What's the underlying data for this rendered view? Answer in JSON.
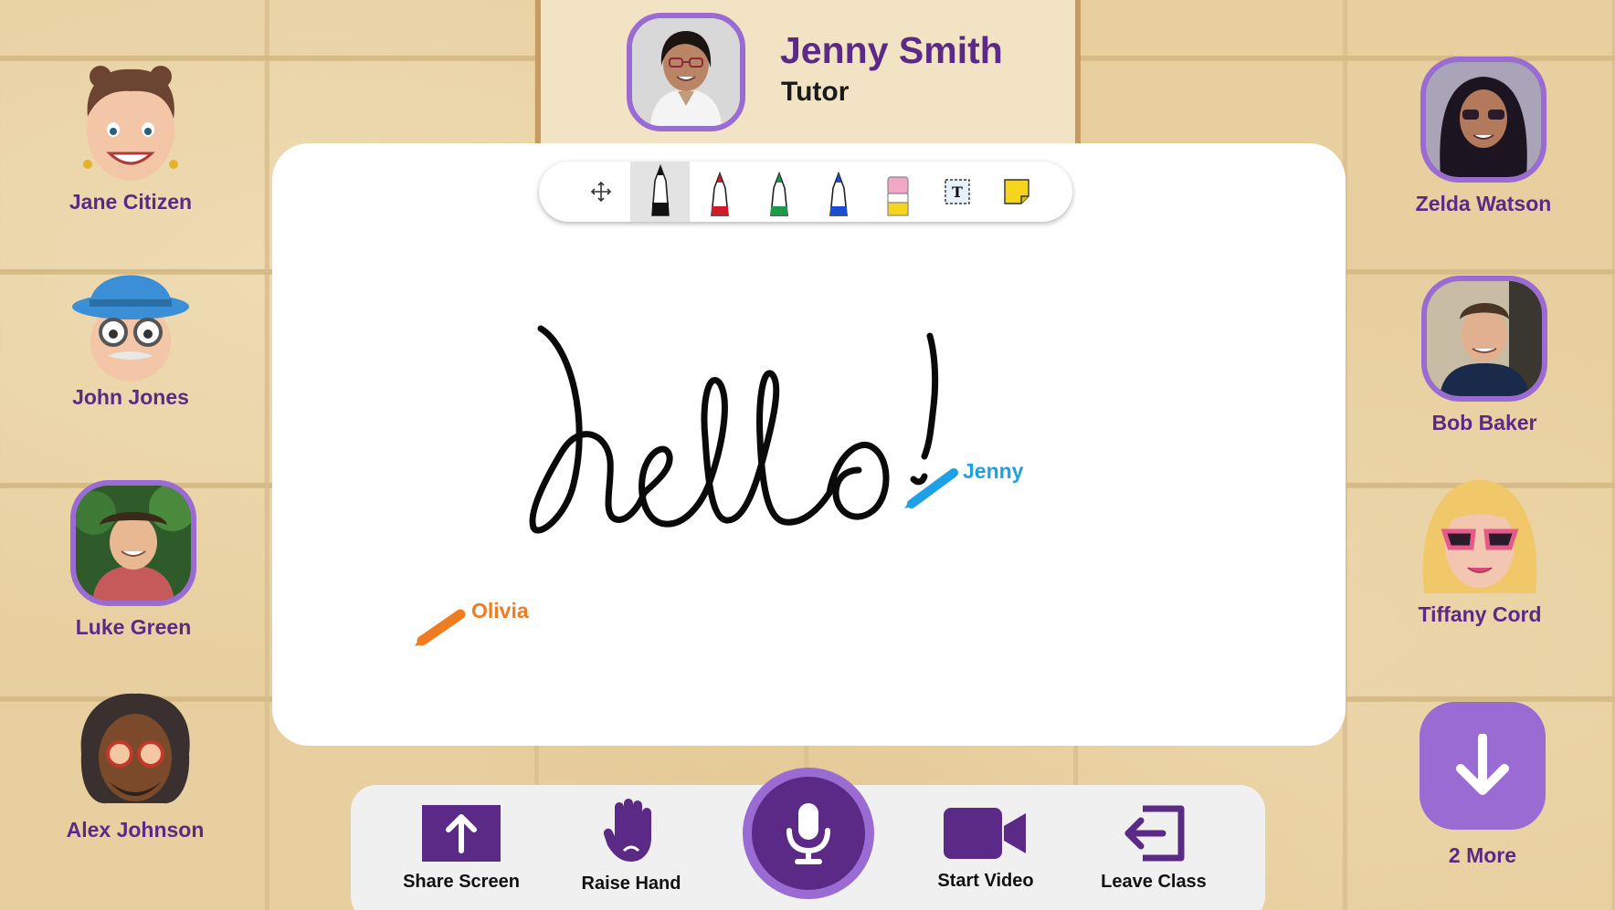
{
  "tutor": {
    "name": "Jenny Smith",
    "role": "Tutor"
  },
  "toolbar": {
    "tools": [
      "move-tool",
      "black-pen",
      "red-pen",
      "green-pen",
      "blue-pen",
      "eraser",
      "text-tool",
      "sticky-note"
    ],
    "active": "black-pen"
  },
  "board": {
    "cursors": [
      {
        "label": "Jenny",
        "color": "#1ea0e6"
      },
      {
        "label": "Olivia",
        "color": "#f07c22"
      }
    ]
  },
  "participants": {
    "left": [
      "Jane Citizen",
      "John Jones",
      "Luke Green",
      "Alex Johnson"
    ],
    "right": [
      "Zelda Watson",
      "Bob Baker",
      "Tiffany Cord"
    ]
  },
  "controls": {
    "share_screen": "Share Screen",
    "raise_hand": "Raise Hand",
    "start_video": "Start Video",
    "leave_class": "Leave Class"
  },
  "more": {
    "label": "2 More"
  },
  "colors": {
    "accent": "#5a2a86",
    "accent_light": "#9a6bd2",
    "panel": "#f0f0f0"
  }
}
